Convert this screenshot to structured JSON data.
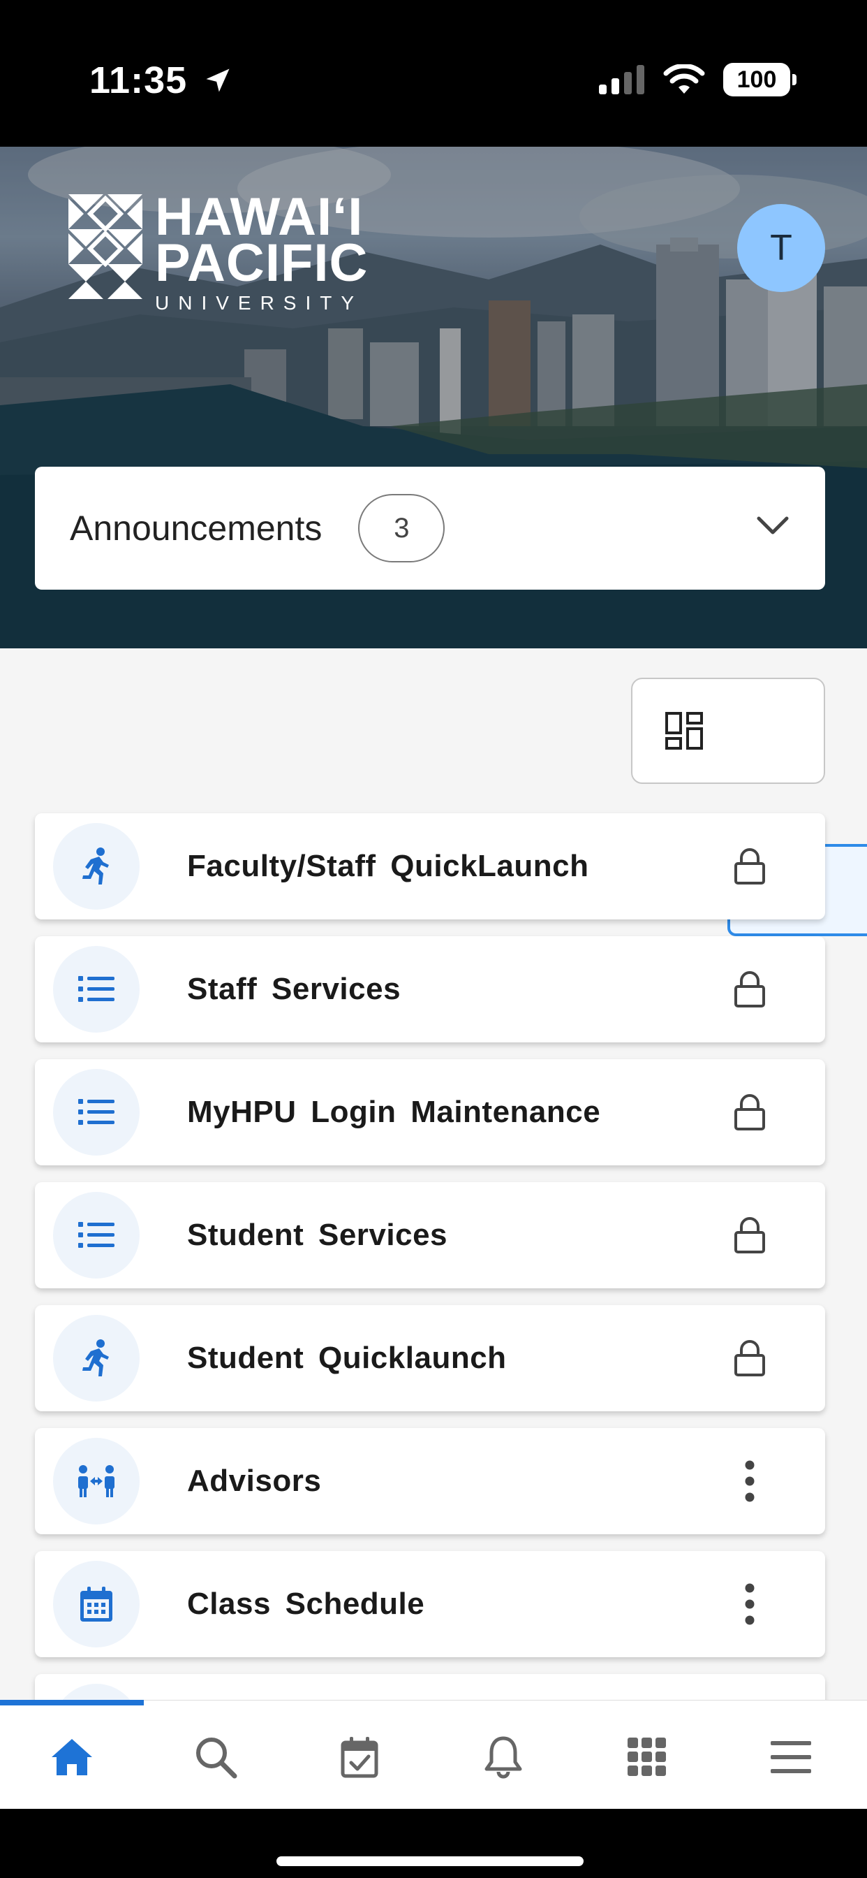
{
  "status_bar": {
    "time": "11:35",
    "battery": "100"
  },
  "header": {
    "logo": {
      "line1": "HAWAIʻI",
      "line2": "PACIFIC",
      "line3": "UNIVERSITY"
    },
    "avatar_initial": "T",
    "announcements": {
      "label": "Announcements",
      "count": "3"
    }
  },
  "view_toggle": {
    "active": "list"
  },
  "items": [
    {
      "label": "Faculty/Staff QuickLaunch",
      "icon": "running-person-icon",
      "action": "lock-icon"
    },
    {
      "label": "Staff Services",
      "icon": "list-icon",
      "action": "lock-icon"
    },
    {
      "label": "MyHPU Login Maintenance",
      "icon": "list-icon",
      "action": "lock-icon"
    },
    {
      "label": "Student Services",
      "icon": "list-icon",
      "action": "lock-icon"
    },
    {
      "label": "Student Quicklaunch",
      "icon": "running-person-icon",
      "action": "lock-icon"
    },
    {
      "label": "Advisors",
      "icon": "advisors-icon",
      "action": "more-vertical-icon"
    },
    {
      "label": "Class Schedule",
      "icon": "calendar-icon",
      "action": "more-vertical-icon"
    }
  ],
  "bottom_nav": [
    {
      "name": "home-icon",
      "active": true
    },
    {
      "name": "search-icon",
      "active": false
    },
    {
      "name": "calendar-check-icon",
      "active": false
    },
    {
      "name": "bell-icon",
      "active": false
    },
    {
      "name": "apps-grid-icon",
      "active": false
    },
    {
      "name": "menu-icon",
      "active": false
    }
  ],
  "colors": {
    "accent": "#1e73d6",
    "icon_blue": "#1f6fd0",
    "avatar_bg": "#8ec6ff",
    "active_toggle_border": "#2e8be8"
  }
}
